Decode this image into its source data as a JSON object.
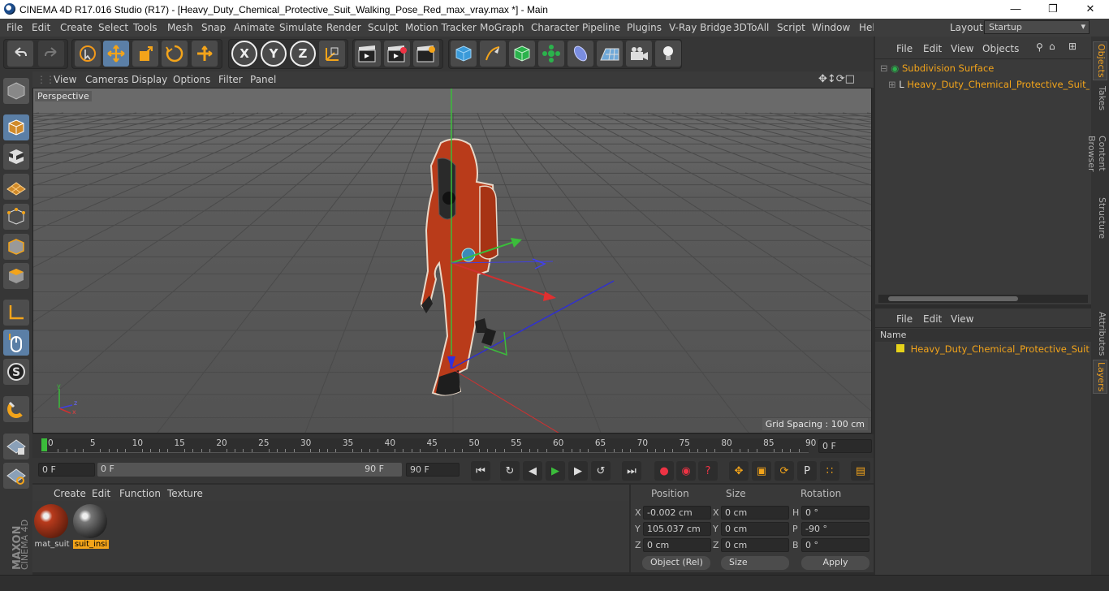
{
  "window": {
    "title": "CINEMA 4D R17.016 Studio (R17) - [Heavy_Duty_Chemical_Protective_Suit_Walking_Pose_Red_max_vray.max *] - Main"
  },
  "menu": [
    "File",
    "Edit",
    "Create",
    "Select",
    "Tools",
    "Mesh",
    "Snap",
    "Animate",
    "Simulate",
    "Render",
    "Sculpt",
    "Motion Tracker",
    "MoGraph",
    "Character",
    "Pipeline",
    "Plugins",
    "V-Ray Bridge",
    "3DToAll",
    "Script",
    "Window",
    "Help"
  ],
  "layout": {
    "label": "Layout:",
    "value": "Startup"
  },
  "toolbar": {
    "x": "X",
    "y": "Y",
    "z": "Z"
  },
  "viewport": {
    "menu": [
      "View",
      "Cameras",
      "Display",
      "Options",
      "Filter",
      "Panel"
    ],
    "camera_label": "Perspective",
    "grid_spacing": "Grid Spacing : 100 cm"
  },
  "timeline": {
    "ticks": [
      "0",
      "5",
      "10",
      "15",
      "20",
      "25",
      "30",
      "35",
      "40",
      "45",
      "50",
      "55",
      "60",
      "65",
      "70",
      "75",
      "80",
      "85",
      "90"
    ],
    "current_frame": "0 F"
  },
  "playback": {
    "start": "0 F",
    "slider_start": "0 F",
    "slider_end": "90 F",
    "end": "90 F"
  },
  "materials": {
    "menu": [
      "Create",
      "Edit",
      "Function",
      "Texture"
    ],
    "items": [
      "mat_suit",
      "suit_insi"
    ]
  },
  "coords": {
    "headers": {
      "position": "Position",
      "size": "Size",
      "rotation": "Rotation"
    },
    "rows": [
      {
        "axis": "X",
        "pos": "-0.002 cm",
        "size_axis": "X",
        "size": "0 cm",
        "rot_axis": "H",
        "rot": "0 °"
      },
      {
        "axis": "Y",
        "pos": "105.037 cm",
        "size_axis": "Y",
        "size": "0 cm",
        "rot_axis": "P",
        "rot": "-90 °"
      },
      {
        "axis": "Z",
        "pos": "0 cm",
        "size_axis": "Z",
        "size": "0 cm",
        "rot_axis": "B",
        "rot": "0 °"
      }
    ],
    "mode": "Object (Rel)",
    "size_mode": "Size",
    "apply": "Apply"
  },
  "objects": {
    "menu": [
      "File",
      "Edit",
      "View",
      "Objects"
    ],
    "items": [
      "Subdivision Surface",
      "Heavy_Duty_Chemical_Protective_Suit_Wal"
    ]
  },
  "layers": {
    "menu": [
      "File",
      "Edit",
      "View"
    ],
    "header": "Name",
    "items": [
      "Heavy_Duty_Chemical_Protective_Suit_Walk"
    ]
  },
  "sidetabs": [
    "Objects",
    "Takes",
    "Content Browser",
    "Structure",
    "Attributes",
    "Layers"
  ],
  "brand": {
    "maxon": "MAXON",
    "c4d": "CINEMA 4D"
  },
  "colors": {
    "accent_orange": "#f3a41a",
    "suit_red": "#c23a16",
    "active_blue": "#5b7fa6"
  }
}
